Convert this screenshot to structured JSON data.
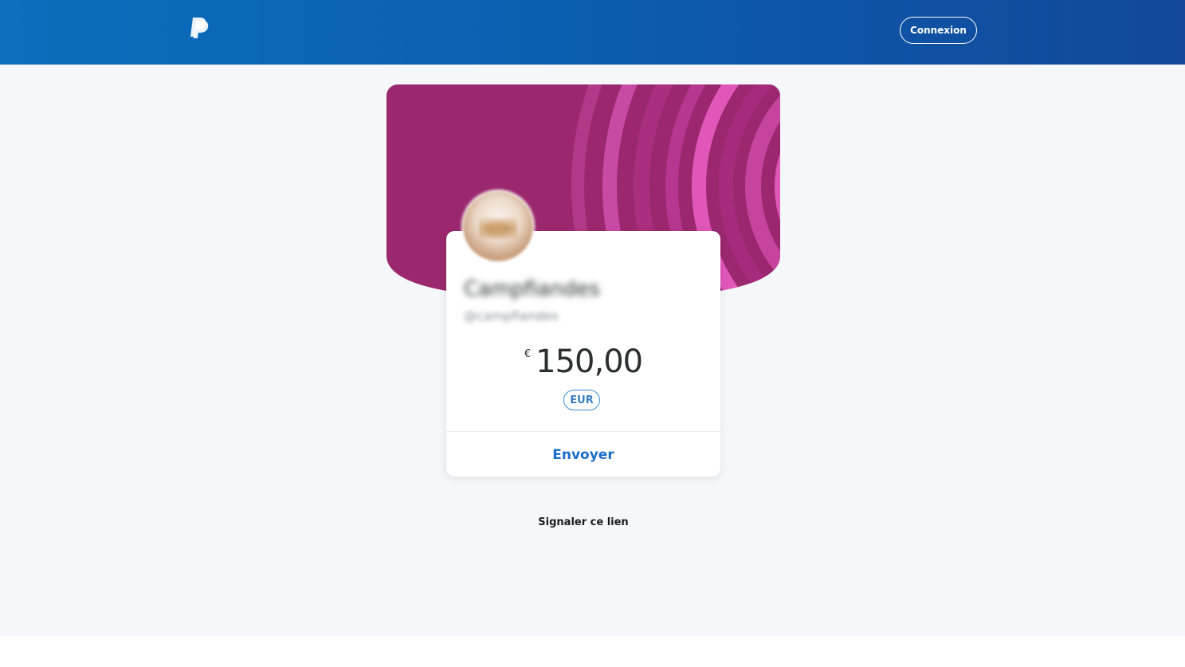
{
  "header": {
    "login_label": "Connexion"
  },
  "profile": {
    "name": "Campfiandes",
    "handle": "@campfiandes"
  },
  "payment": {
    "currency_symbol": "€",
    "amount": "150,00",
    "currency_code": "EUR",
    "send_label": "Envoyer"
  },
  "footer": {
    "report_label": "Signaler ce lien"
  },
  "colors": {
    "header_start": "#0b6ebe",
    "header_end": "#12479a",
    "banner": "#9b286f",
    "banner_accent": "#e04fb4",
    "link_blue": "#1a6ec9",
    "page_bg": "#f5f7fa"
  },
  "icons": {
    "logo": "paypal-logo-icon"
  }
}
